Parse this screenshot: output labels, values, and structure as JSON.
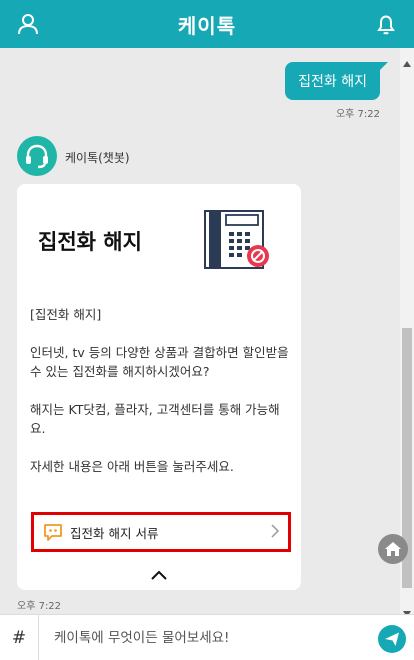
{
  "header": {
    "title": "케이톡",
    "user_icon": "user-icon",
    "bell_icon": "bell-icon"
  },
  "chat": {
    "outgoing": {
      "text": "집전화 해지",
      "time": "오후 7:22"
    },
    "bot": {
      "name": "케이톡(챗봇)",
      "avatar_icon": "headset-icon",
      "card": {
        "title": "집전화 해지",
        "illustration": "phone-cancel-icon",
        "paragraphs": [
          "[집전화 해지]",
          "인터넷, tv 등의 다양한 상품과 결합하면 할인받을 수 있는 집전화를 해지하시겠어요?",
          "해지는 KT닷컴, 플라자, 고객센터를 통해 가능해요.",
          "자세한 내용은 아래 버튼을 눌러주세요."
        ],
        "action_label": "집전화 해지 서류",
        "action_icon": "chat-bubble-icon",
        "collapse_icon": "chevron-up-icon"
      },
      "time": "오후 7:22"
    }
  },
  "input": {
    "hash": "#",
    "placeholder": "케이톡에 무엇이든 물어보세요!",
    "send_icon": "send-icon"
  },
  "colors": {
    "brand": "#16a8b5",
    "highlight": "#e10000",
    "bot_avatar": "#1fb5a7"
  }
}
